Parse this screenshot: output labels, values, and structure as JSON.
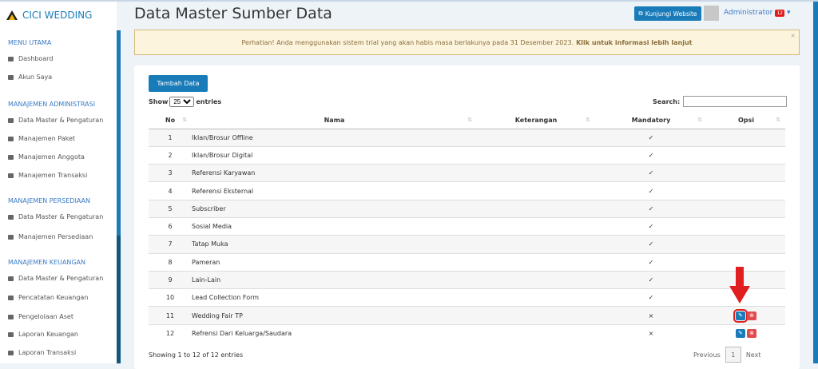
{
  "brand": "CICI WEDDING",
  "sidebar": {
    "sections": [
      {
        "title": "MENU UTAMA",
        "items": [
          "Dashboard",
          "Akun Saya"
        ]
      },
      {
        "title": "MANAJEMEN ADMINISTRASI",
        "items": [
          "Data Master & Pengaturan",
          "Manajemen Paket",
          "Manajemen Anggota",
          "Manajemen Transaksi"
        ]
      },
      {
        "title": "MANAJEMEN PERSEDIAAN",
        "items": [
          "Data Master & Pengaturan",
          "Manajemen Persediaan"
        ]
      },
      {
        "title": "MANAJEMEN KEUANGAN",
        "items": [
          "Data Master & Pengaturan",
          "Pencatatan Keuangan",
          "Pengelolaan Aset",
          "Laporan Keuangan",
          "Laporan Transaksi"
        ]
      }
    ]
  },
  "header": {
    "title": "Data Master Sumber Data",
    "visit": "Kunjungi Website",
    "user": "Administrator",
    "badge": "12"
  },
  "alert": {
    "text": "Perhatian! Anda menggunakan sistem trial yang akan habis masa berlakunya pada 31 Desember 2023.",
    "link": "Klik untuk informasi lebih lanjut",
    "close": "×"
  },
  "toolbar": {
    "add": "Tambah Data",
    "show": "Show",
    "entries": "entries",
    "page_size": "25",
    "search": "Search:"
  },
  "table": {
    "columns": [
      "No",
      "Nama",
      "Keterangan",
      "Mandatory",
      "Opsi"
    ],
    "rows": [
      {
        "no": "1",
        "nama": "Iklan/Brosur Offline",
        "ket": "",
        "mand": "✓",
        "opsi": false
      },
      {
        "no": "2",
        "nama": "Iklan/Brosur Digital",
        "ket": "",
        "mand": "✓",
        "opsi": false
      },
      {
        "no": "3",
        "nama": "Referensi Karyawan",
        "ket": "",
        "mand": "✓",
        "opsi": false
      },
      {
        "no": "4",
        "nama": "Referensi Eksternal",
        "ket": "",
        "mand": "✓",
        "opsi": false
      },
      {
        "no": "5",
        "nama": "Subscriber",
        "ket": "",
        "mand": "✓",
        "opsi": false
      },
      {
        "no": "6",
        "nama": "Sosial Media",
        "ket": "",
        "mand": "✓",
        "opsi": false
      },
      {
        "no": "7",
        "nama": "Tatap Muka",
        "ket": "",
        "mand": "✓",
        "opsi": false
      },
      {
        "no": "8",
        "nama": "Pameran",
        "ket": "",
        "mand": "✓",
        "opsi": false
      },
      {
        "no": "9",
        "nama": "Lain-Lain",
        "ket": "",
        "mand": "✓",
        "opsi": false
      },
      {
        "no": "10",
        "nama": "Lead Collection Form",
        "ket": "",
        "mand": "✓",
        "opsi": false
      },
      {
        "no": "11",
        "nama": "Wedding Fair TP",
        "ket": "",
        "mand": "×",
        "opsi": true
      },
      {
        "no": "12",
        "nama": "Refrensi Dari Keluarga/Saudara",
        "ket": "",
        "mand": "×",
        "opsi": true
      }
    ]
  },
  "footer": {
    "info": "Showing 1 to 12 of 12 entries",
    "prev": "Previous",
    "page": "1",
    "next": "Next"
  },
  "colors": {
    "primary": "#1a7bb9",
    "danger": "#e24b4b",
    "highlight": "#e02020"
  }
}
